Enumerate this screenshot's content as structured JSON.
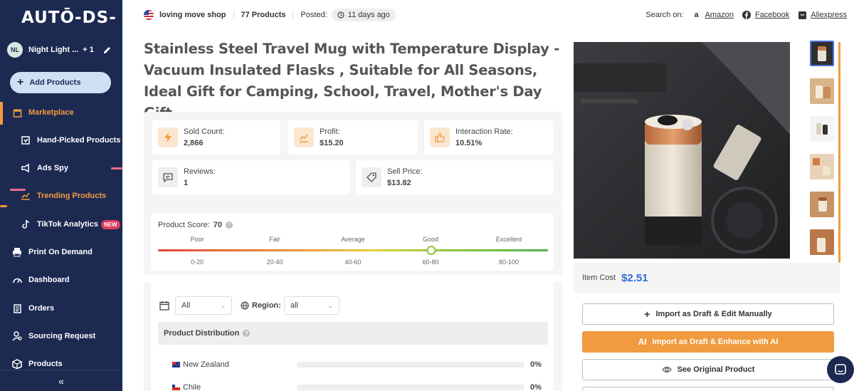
{
  "sidebar": {
    "logo": "AUTŌ-DS-",
    "user": {
      "initials": "NL",
      "name": "Night Light ...",
      "extra": "+ 1"
    },
    "add_products": "Add Products",
    "items": [
      {
        "label": "Marketplace"
      },
      {
        "label": "Hand-Picked Products"
      },
      {
        "label": "Ads Spy"
      },
      {
        "label": "Trending Products"
      },
      {
        "label": "TikTok Analytics",
        "badge": "NEW"
      },
      {
        "label": "Print On Demand"
      },
      {
        "label": "Dashboard"
      },
      {
        "label": "Orders"
      },
      {
        "label": "Sourcing Request"
      },
      {
        "label": "Products"
      }
    ],
    "collapse": "«"
  },
  "topbar": {
    "shop": "loving move shop",
    "products": "77 Products",
    "posted_label": "Posted:",
    "posted_value": "11 days ago",
    "search_on": "Search on:",
    "links": [
      "Amazon",
      "Facebook",
      "Aliexpress"
    ]
  },
  "product": {
    "title": "Stainless Steel Travel Mug with Temperature Display - Vacuum Insulated Flasks , Suitable for All Seasons, Ideal Gift for Camping, School, Travel, Mother's Day Gift"
  },
  "stats": {
    "sold_label": "Sold Count:",
    "sold_value": "2,866",
    "profit_label": "Profit:",
    "profit_value": "$15.20",
    "interaction_label": "Interaction Rate:",
    "interaction_value": "10.51%",
    "reviews_label": "Reviews:",
    "reviews_value": "1",
    "sell_label": "Sell Price:",
    "sell_value": "$13.82"
  },
  "score": {
    "label": "Product Score:",
    "value": "70",
    "value_fraction": 0.7,
    "grades": [
      "Poor",
      "Fair",
      "Average",
      "Good",
      "Excellent"
    ],
    "ranges": [
      "0-20",
      "20-40",
      "40-60",
      "60-80",
      "80-100"
    ]
  },
  "distribution": {
    "date_filter": "All",
    "region_label": "Region:",
    "region_value": "all",
    "header": "Product Distribution",
    "rows": [
      {
        "country": "New Zealand",
        "pct": "0%"
      },
      {
        "country": "Chile",
        "pct": "0%"
      }
    ]
  },
  "pricing": {
    "item_cost_label": "Item Cost",
    "item_cost_value": "$2.51"
  },
  "actions": {
    "import_manual": "Import as Draft & Edit Manually",
    "import_ai": "Import as Draft & Enhance with AI",
    "see_original": "See Original Product"
  },
  "colors": {
    "sidebar": "#1c2a52",
    "accent": "#f29b3d",
    "link_blue": "#2d6cdf"
  }
}
